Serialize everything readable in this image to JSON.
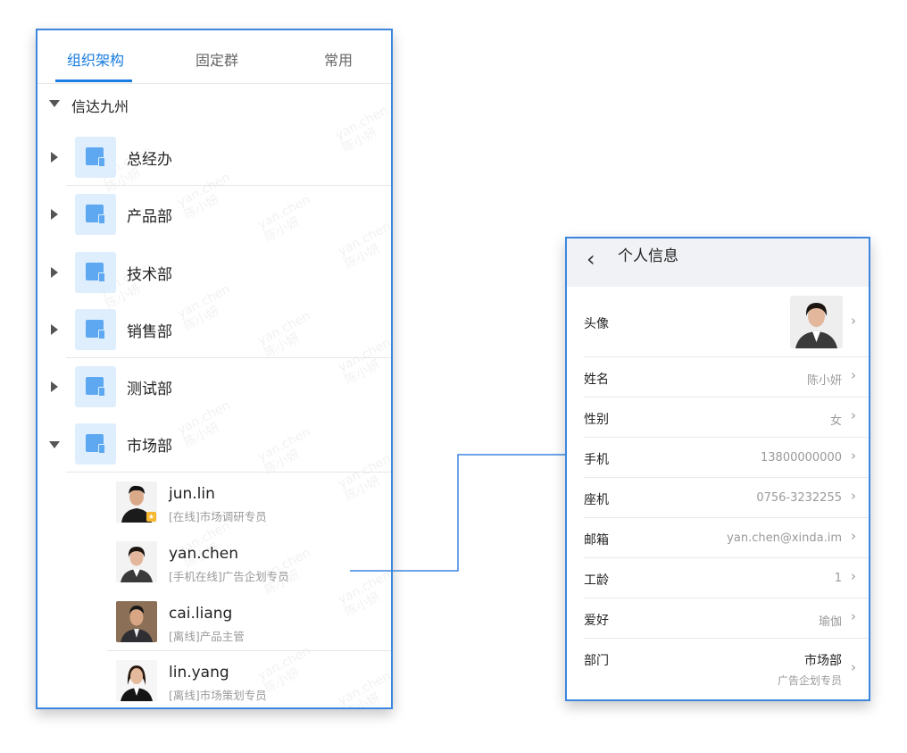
{
  "tabs": [
    "组织架构",
    "固定群",
    "常用"
  ],
  "org": {
    "root": "信达九州",
    "departments": [
      "总经办",
      "产品部",
      "技术部",
      "销售部",
      "测试部",
      "市场部"
    ],
    "members": [
      {
        "name": "jun.lin",
        "status": "[在线]市场调研专员"
      },
      {
        "name": "yan.chen",
        "status": "[手机在线]广告企划专员"
      },
      {
        "name": "cai.liang",
        "status": "[离线]产品主管"
      },
      {
        "name": "lin.yang",
        "status": "[离线]市场策划专员"
      }
    ]
  },
  "watermark": {
    "line1": "yan.chen",
    "line2": "陈小妍"
  },
  "profile": {
    "title": "个人信息",
    "avatar_label": "头像",
    "fields": [
      {
        "label": "姓名",
        "value": "陈小妍"
      },
      {
        "label": "性别",
        "value": "女"
      },
      {
        "label": "手机",
        "value": "13800000000"
      },
      {
        "label": "座机",
        "value": "0756-3232255"
      },
      {
        "label": "邮箱",
        "value": "yan.chen@xinda.im"
      },
      {
        "label": "工龄",
        "value": "1"
      },
      {
        "label": "爱好",
        "value": "瑜伽"
      }
    ],
    "department": {
      "label": "部门",
      "value": "市场部",
      "sub": "广告企划专员"
    }
  },
  "colors": {
    "accent": "#1a7de0",
    "frame": "#3d86e0",
    "icon_bg": "#deeefd",
    "icon_fg": "#5ea8f2"
  }
}
